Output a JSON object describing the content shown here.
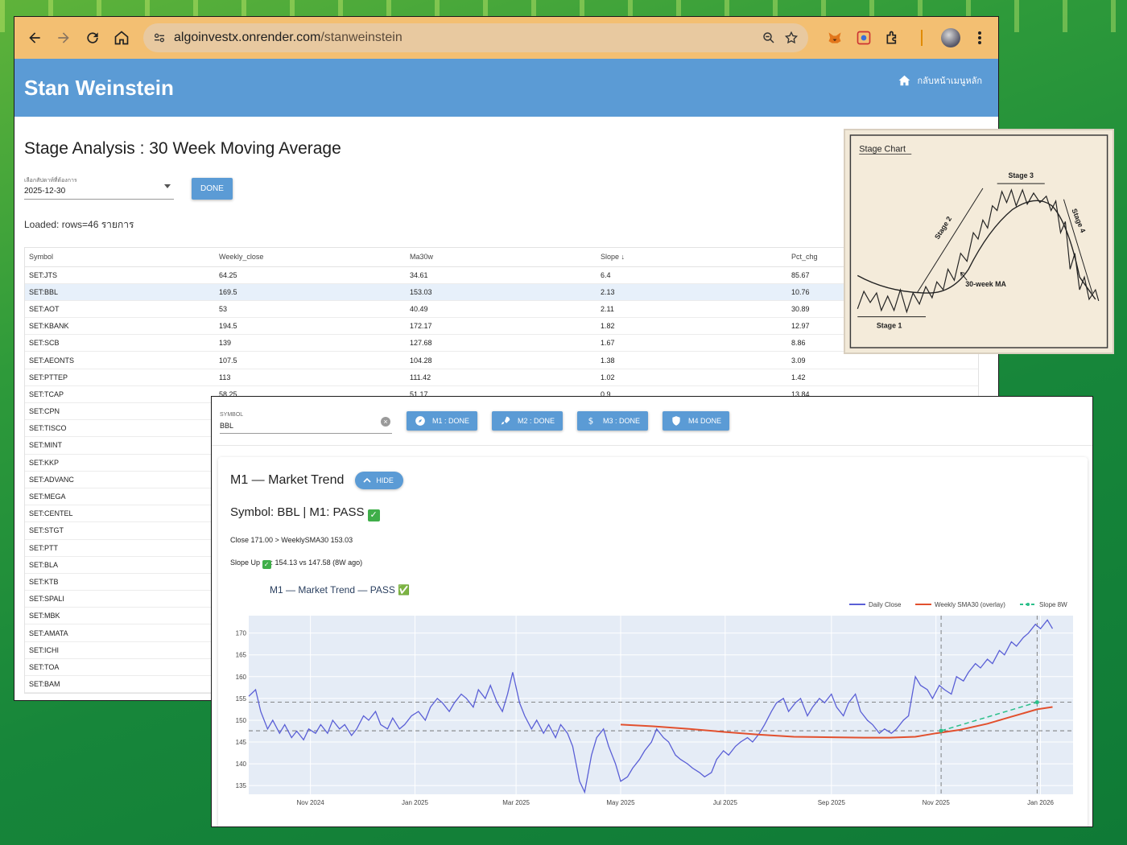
{
  "browser": {
    "url_host": "algoinvestx.onrender.com",
    "url_path": "/stanweinstein"
  },
  "app": {
    "title": "Stan Weinstein",
    "home_link": "กลับหน้าเมนูหลัก"
  },
  "page": {
    "title": "Stage Analysis : 30 Week Moving Average",
    "date_label": "เลือกสัปดาห์ที่ต้องการ",
    "date_value": "2025-12-30",
    "done_label": "DONE",
    "loaded_text": "Loaded: rows=46 รายการ"
  },
  "table": {
    "headers": [
      "Symbol",
      "Weekly_close",
      "Ma30w",
      "Slope ↓",
      "Pct_chg"
    ],
    "rows": [
      [
        "SET:JTS",
        "64.25",
        "34.61",
        "6.4",
        "85.67"
      ],
      [
        "SET:BBL",
        "169.5",
        "153.03",
        "2.13",
        "10.76"
      ],
      [
        "SET:AOT",
        "53",
        "40.49",
        "2.11",
        "30.89"
      ],
      [
        "SET:KBANK",
        "194.5",
        "172.17",
        "1.82",
        "12.97"
      ],
      [
        "SET:SCB",
        "139",
        "127.68",
        "1.67",
        "8.86"
      ],
      [
        "SET:AEONTS",
        "107.5",
        "104.28",
        "1.38",
        "3.09"
      ],
      [
        "SET:PTTEP",
        "113",
        "111.42",
        "1.02",
        "1.42"
      ],
      [
        "SET:TCAP",
        "58.25",
        "51.17",
        "0.9",
        "13.84"
      ],
      [
        "SET:CPN",
        "",
        "",
        "",
        ""
      ],
      [
        "SET:TISCO",
        "",
        "",
        "",
        ""
      ],
      [
        "SET:MINT",
        "",
        "",
        "",
        ""
      ],
      [
        "SET:KKP",
        "",
        "",
        "",
        ""
      ],
      [
        "SET:ADVANC",
        "",
        "",
        "",
        ""
      ],
      [
        "SET:MEGA",
        "",
        "",
        "",
        ""
      ],
      [
        "SET:CENTEL",
        "",
        "",
        "",
        ""
      ],
      [
        "SET:STGT",
        "",
        "",
        "",
        ""
      ],
      [
        "SET:PTT",
        "",
        "",
        "",
        ""
      ],
      [
        "SET:BLA",
        "",
        "",
        "",
        ""
      ],
      [
        "SET:KTB",
        "",
        "",
        "",
        ""
      ],
      [
        "SET:SPALI",
        "",
        "",
        "",
        ""
      ],
      [
        "SET:MBK",
        "",
        "",
        "",
        ""
      ],
      [
        "SET:AMATA",
        "",
        "",
        "",
        ""
      ],
      [
        "SET:ICHI",
        "",
        "",
        "",
        ""
      ],
      [
        "SET:TOA",
        "",
        "",
        "",
        ""
      ],
      [
        "SET:BAM",
        "",
        "",
        "",
        ""
      ]
    ]
  },
  "stage_chart": {
    "title": "Stage Chart",
    "stage1": "Stage 1",
    "stage2": "Stage 2",
    "stage3": "Stage 3",
    "stage4": "Stage 4",
    "ma_label": "30-week MA"
  },
  "detail": {
    "symbol_label": "SYMBOL",
    "symbol_value": "BBL",
    "buttons": [
      "M1 : DONE",
      "M2 : DONE",
      "M3 : DONE",
      "M4 DONE"
    ],
    "card_title": "M1 — Market Trend",
    "hide_label": "HIDE",
    "result_text": "Symbol: BBL | M1: PASS",
    "close_text": "Close 171.00 > WeeklySMA30 153.03",
    "slope_prefix": "Slope Up",
    "slope_suffix": ": 154.13 vs 147.58 (8W ago)"
  },
  "chart_data": {
    "type": "line",
    "title": "M1 — Market Trend — PASS ✅",
    "xlabel": "",
    "ylabel": "",
    "xlim": [
      "2024-09-26",
      "2026-01-20"
    ],
    "ylim": [
      133,
      174
    ],
    "x_ticks": [
      "Nov 2024",
      "Jan 2025",
      "Mar 2025",
      "May 2025",
      "Jul 2025",
      "Sep 2025",
      "Nov 2025",
      "Jan 2026"
    ],
    "x_tick_dates": [
      "2024-11-01",
      "2025-01-01",
      "2025-03-01",
      "2025-05-01",
      "2025-07-01",
      "2025-09-01",
      "2025-11-01",
      "2026-01-01"
    ],
    "y_ticks": [
      135,
      140,
      145,
      150,
      155,
      160,
      165,
      170
    ],
    "grid": true,
    "legend_position": "top-right",
    "colors": {
      "daily": "#5a5fd6",
      "sma": "#e2502e",
      "slope": "#2bbf8a",
      "plot_bg": "#e5ecf6"
    },
    "reference_lines": [
      154.13,
      147.58
    ],
    "reference_dates": [
      "2025-11-04",
      "2025-12-30"
    ],
    "series": [
      {
        "name": "Daily Close",
        "points": [
          [
            "2024-09-26",
            155.5
          ],
          [
            "2024-09-30",
            157
          ],
          [
            "2024-10-03",
            152
          ],
          [
            "2024-10-07",
            148
          ],
          [
            "2024-10-10",
            150
          ],
          [
            "2024-10-14",
            147
          ],
          [
            "2024-10-17",
            149
          ],
          [
            "2024-10-21",
            146
          ],
          [
            "2024-10-24",
            147.5
          ],
          [
            "2024-10-28",
            145.5
          ],
          [
            "2024-10-31",
            148
          ],
          [
            "2024-11-04",
            147
          ],
          [
            "2024-11-07",
            149
          ],
          [
            "2024-11-11",
            147
          ],
          [
            "2024-11-14",
            150
          ],
          [
            "2024-11-18",
            148
          ],
          [
            "2024-11-21",
            149
          ],
          [
            "2024-11-25",
            146.5
          ],
          [
            "2024-11-28",
            148
          ],
          [
            "2024-12-02",
            151
          ],
          [
            "2024-12-05",
            150
          ],
          [
            "2024-12-09",
            152
          ],
          [
            "2024-12-12",
            149
          ],
          [
            "2024-12-16",
            148
          ],
          [
            "2024-12-19",
            150.5
          ],
          [
            "2024-12-23",
            148
          ],
          [
            "2024-12-26",
            149
          ],
          [
            "2024-12-30",
            151
          ],
          [
            "2025-01-03",
            152
          ],
          [
            "2025-01-07",
            150
          ],
          [
            "2025-01-10",
            153
          ],
          [
            "2025-01-14",
            155
          ],
          [
            "2025-01-17",
            154
          ],
          [
            "2025-01-21",
            152
          ],
          [
            "2025-01-24",
            154
          ],
          [
            "2025-01-28",
            156
          ],
          [
            "2025-01-31",
            155
          ],
          [
            "2025-02-04",
            153
          ],
          [
            "2025-02-07",
            157
          ],
          [
            "2025-02-11",
            155
          ],
          [
            "2025-02-14",
            158
          ],
          [
            "2025-02-18",
            154
          ],
          [
            "2025-02-21",
            152
          ],
          [
            "2025-02-24",
            156
          ],
          [
            "2025-02-27",
            161
          ],
          [
            "2025-03-03",
            154
          ],
          [
            "2025-03-06",
            151
          ],
          [
            "2025-03-10",
            148
          ],
          [
            "2025-03-13",
            150
          ],
          [
            "2025-03-17",
            147
          ],
          [
            "2025-03-20",
            149
          ],
          [
            "2025-03-24",
            146
          ],
          [
            "2025-03-27",
            149
          ],
          [
            "2025-03-31",
            147
          ],
          [
            "2025-04-03",
            144
          ],
          [
            "2025-04-07",
            136
          ],
          [
            "2025-04-10",
            133.5
          ],
          [
            "2025-04-14",
            142
          ],
          [
            "2025-04-17",
            146
          ],
          [
            "2025-04-21",
            148
          ],
          [
            "2025-04-24",
            144
          ],
          [
            "2025-04-28",
            140
          ],
          [
            "2025-05-01",
            136
          ],
          [
            "2025-05-05",
            137
          ],
          [
            "2025-05-08",
            139
          ],
          [
            "2025-05-12",
            141
          ],
          [
            "2025-05-15",
            143
          ],
          [
            "2025-05-19",
            145
          ],
          [
            "2025-05-22",
            148
          ],
          [
            "2025-05-26",
            146
          ],
          [
            "2025-05-29",
            145
          ],
          [
            "2025-06-02",
            142
          ],
          [
            "2025-06-05",
            141
          ],
          [
            "2025-06-09",
            140
          ],
          [
            "2025-06-12",
            139
          ],
          [
            "2025-06-16",
            138
          ],
          [
            "2025-06-19",
            137
          ],
          [
            "2025-06-23",
            138
          ],
          [
            "2025-06-26",
            141
          ],
          [
            "2025-06-30",
            143
          ],
          [
            "2025-07-03",
            142
          ],
          [
            "2025-07-07",
            144
          ],
          [
            "2025-07-10",
            145
          ],
          [
            "2025-07-14",
            146
          ],
          [
            "2025-07-17",
            145
          ],
          [
            "2025-07-21",
            147
          ],
          [
            "2025-07-24",
            149
          ],
          [
            "2025-07-28",
            152
          ],
          [
            "2025-07-31",
            154
          ],
          [
            "2025-08-04",
            155
          ],
          [
            "2025-08-07",
            152
          ],
          [
            "2025-08-11",
            154
          ],
          [
            "2025-08-14",
            155
          ],
          [
            "2025-08-18",
            151
          ],
          [
            "2025-08-21",
            153
          ],
          [
            "2025-08-25",
            155
          ],
          [
            "2025-08-28",
            154
          ],
          [
            "2025-09-01",
            156
          ],
          [
            "2025-09-04",
            153
          ],
          [
            "2025-09-08",
            151
          ],
          [
            "2025-09-11",
            154
          ],
          [
            "2025-09-15",
            156
          ],
          [
            "2025-09-18",
            152
          ],
          [
            "2025-09-22",
            150
          ],
          [
            "2025-09-25",
            149
          ],
          [
            "2025-09-29",
            147
          ],
          [
            "2025-10-02",
            148
          ],
          [
            "2025-10-06",
            147
          ],
          [
            "2025-10-09",
            148
          ],
          [
            "2025-10-13",
            150
          ],
          [
            "2025-10-16",
            151
          ],
          [
            "2025-10-20",
            160
          ],
          [
            "2025-10-23",
            158
          ],
          [
            "2025-10-27",
            157
          ],
          [
            "2025-10-30",
            155
          ],
          [
            "2025-11-03",
            158
          ],
          [
            "2025-11-06",
            157
          ],
          [
            "2025-11-10",
            156
          ],
          [
            "2025-11-13",
            160
          ],
          [
            "2025-11-17",
            159
          ],
          [
            "2025-11-20",
            161
          ],
          [
            "2025-11-24",
            163
          ],
          [
            "2025-11-27",
            162
          ],
          [
            "2025-12-01",
            164
          ],
          [
            "2025-12-04",
            163
          ],
          [
            "2025-12-08",
            166
          ],
          [
            "2025-12-11",
            165
          ],
          [
            "2025-12-15",
            168
          ],
          [
            "2025-12-18",
            167
          ],
          [
            "2025-12-22",
            169
          ],
          [
            "2025-12-25",
            170
          ],
          [
            "2025-12-29",
            172
          ],
          [
            "2026-01-01",
            171
          ],
          [
            "2026-01-05",
            173
          ],
          [
            "2026-01-08",
            171
          ]
        ]
      },
      {
        "name": "Weekly SMA30 (overlay)",
        "points": [
          [
            "2025-05-01",
            149
          ],
          [
            "2025-05-20",
            148.6
          ],
          [
            "2025-06-10",
            148
          ],
          [
            "2025-07-01",
            147.3
          ],
          [
            "2025-07-20",
            146.7
          ],
          [
            "2025-08-10",
            146.2
          ],
          [
            "2025-09-01",
            146.1
          ],
          [
            "2025-09-20",
            146
          ],
          [
            "2025-10-05",
            146
          ],
          [
            "2025-10-20",
            146.2
          ],
          [
            "2025-11-01",
            147
          ],
          [
            "2025-11-15",
            147.8
          ],
          [
            "2025-12-01",
            149.2
          ],
          [
            "2025-12-15",
            150.8
          ],
          [
            "2025-12-30",
            152.5
          ],
          [
            "2026-01-08",
            153.03
          ]
        ]
      },
      {
        "name": "Slope 8W",
        "points": [
          [
            "2025-11-04",
            147.58
          ],
          [
            "2025-12-30",
            154.13
          ]
        ]
      }
    ]
  }
}
